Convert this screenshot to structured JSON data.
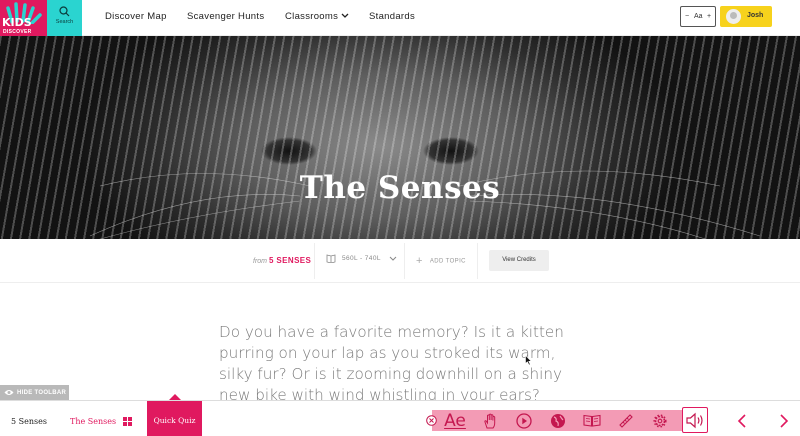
{
  "header": {
    "logo_text": "KIDS",
    "logo_subtext": "DISCOVER",
    "search_label": "Search",
    "nav": [
      "Discover Map",
      "Scavenger Hunts",
      "Classrooms",
      "Standards"
    ],
    "font_size_control": {
      "minus": "−",
      "label": "Aa",
      "plus": "+"
    },
    "user_name": "Josh"
  },
  "hero": {
    "title": "The Senses"
  },
  "meta": {
    "from_label": "from",
    "from_source": "5 SENSES",
    "lexile": "560L - 740L",
    "add_topic": "ADD TOPIC",
    "credits_button": "View Credits"
  },
  "article": {
    "paragraph": "Do you have a favorite memory? Is it a kitten purring on your lap as you stroked its warm, silky fur? Or is it zooming downhill on a shiny new bike with wind whistling in your ears?"
  },
  "toolbar_toggle": "HIDE TOOLBAR",
  "bottombar": {
    "collection": "5 Senses",
    "article": "The Senses",
    "quiz": "Quick Quiz",
    "text_tool": "Ae"
  },
  "colors": {
    "brand": "#e0195f",
    "teal": "#2ad4d0",
    "yellow": "#f7d21c",
    "toolbar": "#f39bb5"
  },
  "icons": [
    "search-icon",
    "chevron-down-icon",
    "book-icon",
    "plus-icon",
    "eye-icon",
    "grid-icon",
    "close-icon",
    "hand-icon",
    "play-icon",
    "globe-icon",
    "open-book-icon",
    "ruler-icon",
    "gear-icon",
    "speaker-icon",
    "chevron-left-icon",
    "chevron-right-icon"
  ]
}
